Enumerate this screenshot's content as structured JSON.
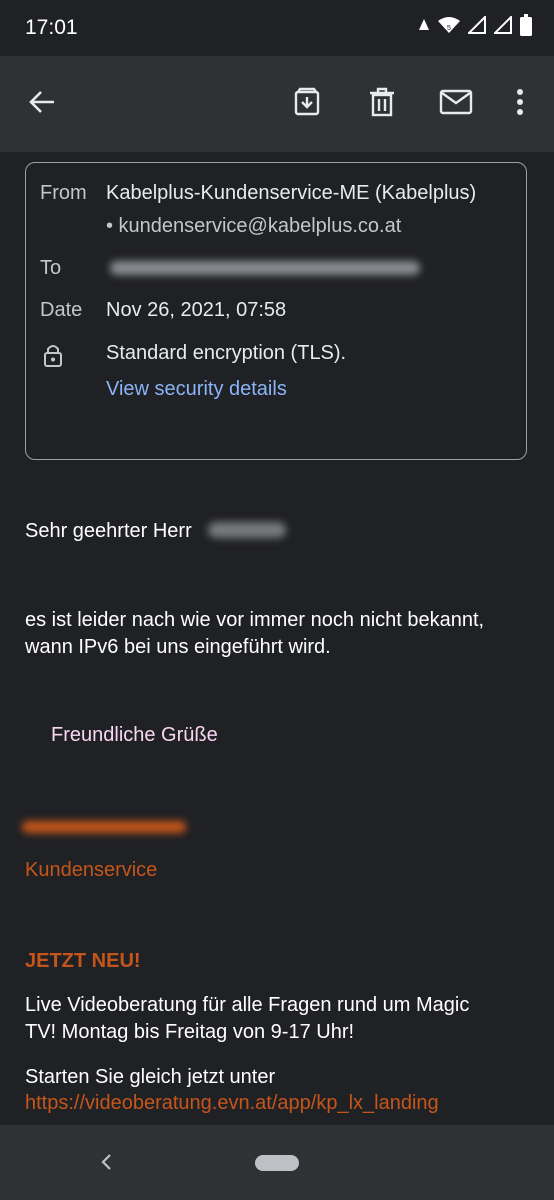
{
  "status_bar": {
    "time": "17:01",
    "icons": [
      "alert-icon",
      "wifi-icon",
      "signal-icon",
      "signal-icon",
      "battery-icon"
    ]
  },
  "app_bar": {
    "icons": [
      "back-arrow-icon",
      "archive-icon",
      "delete-icon",
      "mark-unread-icon",
      "more-vert-icon"
    ]
  },
  "header": {
    "from_label": "From",
    "from_name": "Kabelplus-Kundenservice-ME (Kabelplus)",
    "from_email": "• kundenservice@kabelplus.co.at",
    "to_label": "To",
    "date_label": "Date",
    "date_value": "Nov 26, 2021, 07:58",
    "encryption_text": "Standard encryption (TLS).",
    "security_link": "View security details"
  },
  "body": {
    "greeting": "Sehr geehrter Herr",
    "paragraph_line1": "es ist leider nach wie vor immer noch nicht bekannt,",
    "paragraph_line2": "wann IPv6 bei uns eingeführt wird.",
    "closing": "Freundliche Grüße",
    "signature_dept": "Kundenservice",
    "promo_heading": "JETZT NEU!",
    "promo_line1": "Live Videoberatung für alle Fragen rund um Magic",
    "promo_line2": "TV! Montag bis Freitag von 9-17 Uhr!",
    "start_text": "Starten Sie gleich jetzt unter",
    "url": "https://videoberatung.evn.at/app/kp_lx_landing"
  },
  "colors": {
    "background": "#202124",
    "bar": "#303134",
    "link_blue": "#8ab4f8",
    "accent_orange": "#c5561b",
    "closing_pink": "#f8d6f4"
  }
}
